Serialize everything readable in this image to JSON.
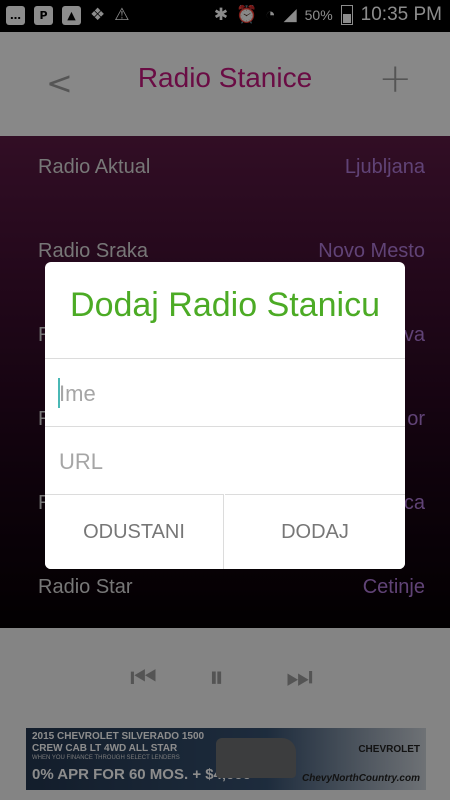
{
  "status_bar": {
    "battery": "50%",
    "time": "10:35 PM"
  },
  "header": {
    "title": "Radio Stanice"
  },
  "stations": [
    {
      "name": "Radio Aktual",
      "city": "Ljubljana"
    },
    {
      "name": "Radio Sraka",
      "city": "Novo Mesto"
    },
    {
      "name": "R",
      "city": "va"
    },
    {
      "name": "R",
      "city": "or"
    },
    {
      "name": "R",
      "city": "ca"
    },
    {
      "name": "Radio Star",
      "city": "Cetinje"
    }
  ],
  "dialog": {
    "title": "Dodaj Radio Stanicu",
    "name_placeholder": "Ime",
    "url_placeholder": "URL",
    "cancel_label": "ODUSTANI",
    "add_label": "DODAJ"
  },
  "ad": {
    "line1": "2015 CHEVROLET SILVERADO 1500",
    "line2": "CREW CAB LT 4WD ALL STAR",
    "line3": "WHEN YOU FINANCE THROUGH SELECT LENDERS",
    "line4": "0% APR FOR 60 MOS. + $4,000",
    "brand": "CHEVROLET",
    "url": "ChevyNorthCountry.com"
  }
}
